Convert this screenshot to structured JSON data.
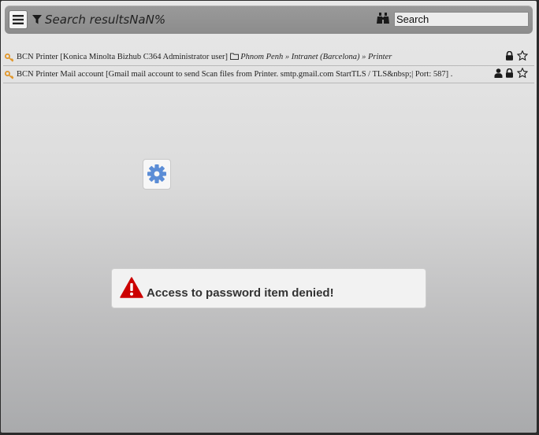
{
  "header": {
    "title": "Search resultsNaN%",
    "search_placeholder": "Search"
  },
  "results": [
    {
      "label": "BCN Printer [Konica Minolta Bizhub C364 Administrator user]",
      "path": "Phnom Penh » Intranet (Barcelona) » Printer",
      "icons": [
        "lock-icon",
        "star-icon"
      ]
    },
    {
      "label": "BCN Printer Mail account [Gmail mail account to send Scan files from Printer. smtp.gmail.com StartTLS / TLS&nbsp;| Port: 587] .",
      "icons": [
        "user-icon",
        "lock-icon",
        "star-icon"
      ]
    }
  ],
  "alert": {
    "message": "Access to password item denied!",
    "icon": "warning-icon",
    "color": "#cc0000"
  },
  "loader": {
    "icon": "gear-icon",
    "color": "#5b8dd6"
  },
  "colors": {
    "key_icon": "#e0962a"
  }
}
